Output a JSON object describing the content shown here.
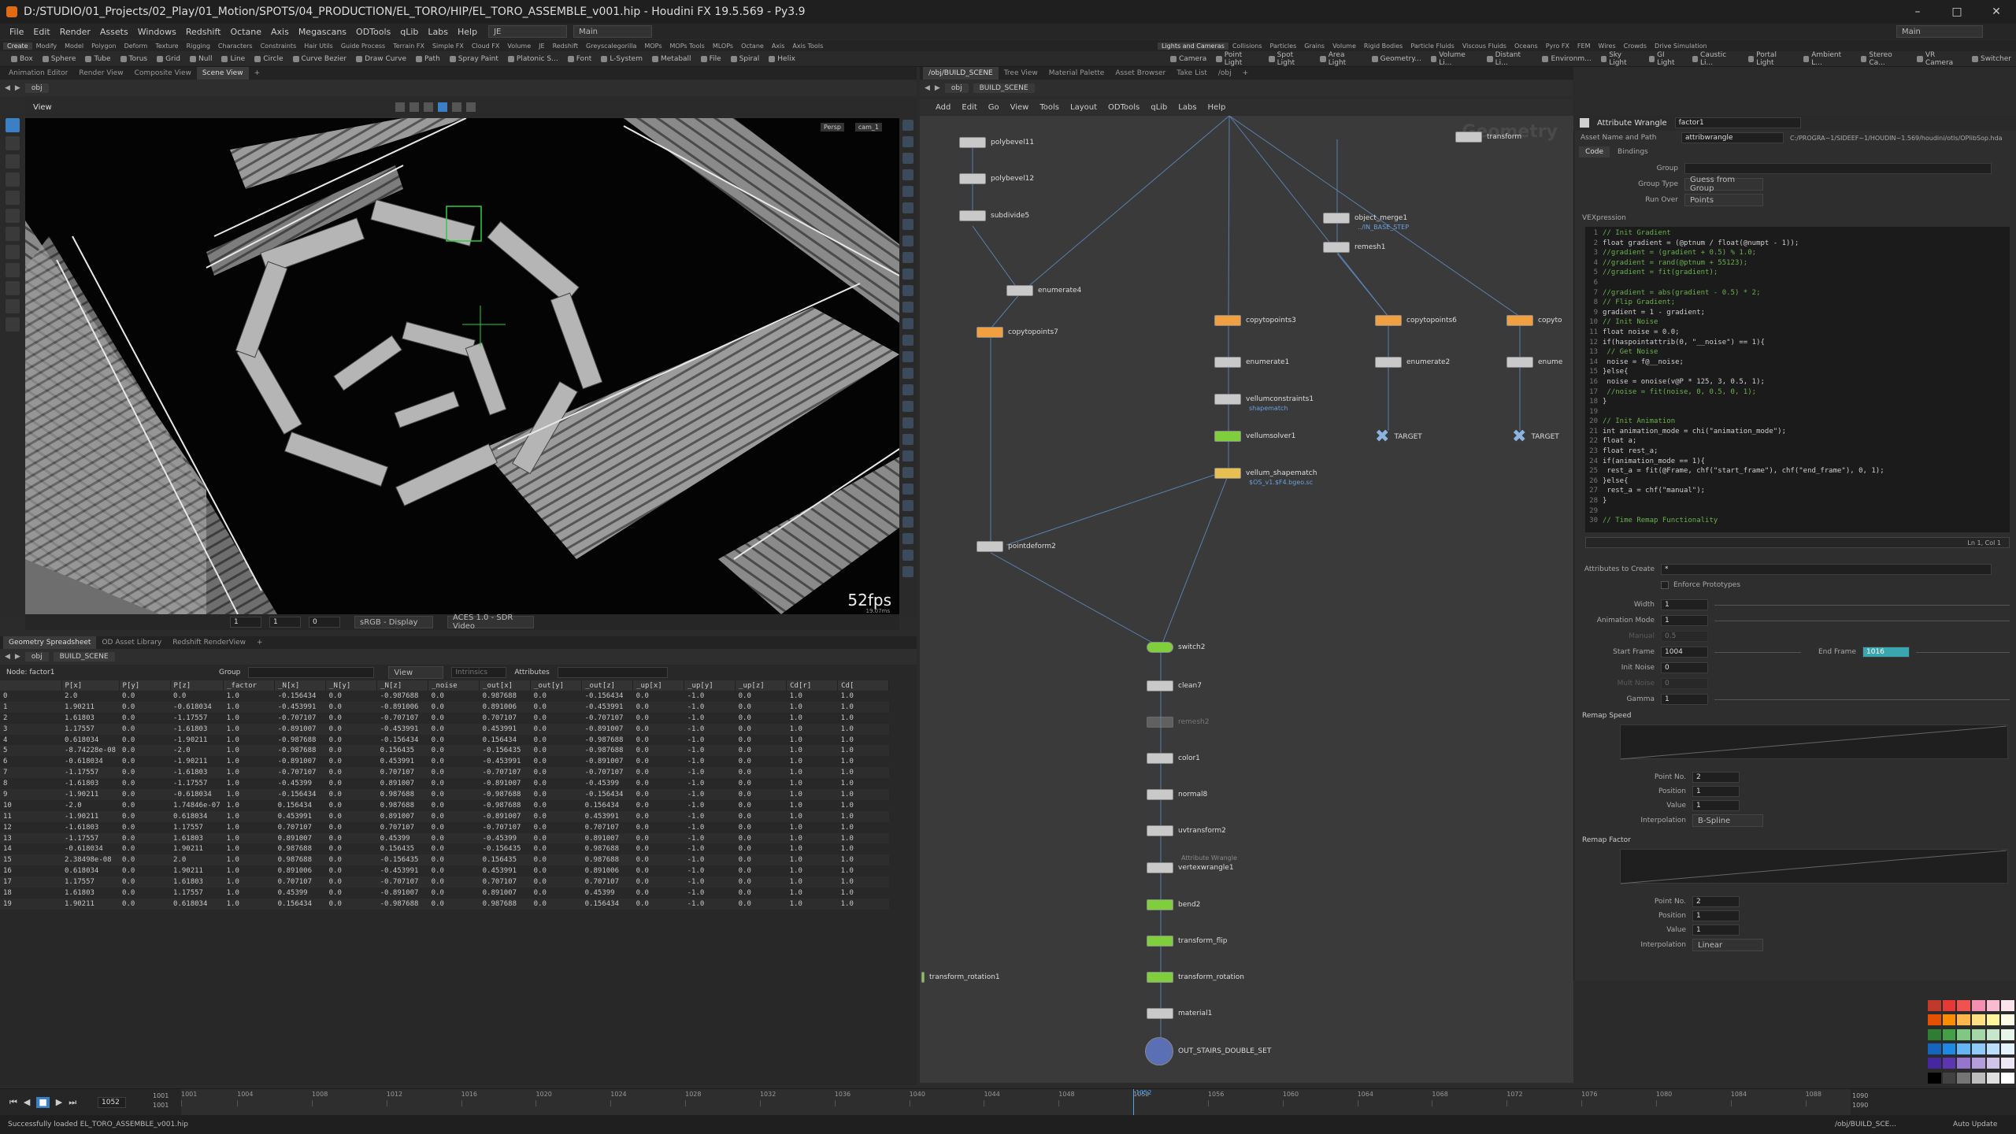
{
  "window": {
    "title": "D:/STUDIO/01_Projects/02_Play/01_Motion/SPOTS/04_PRODUCTION/EL_TORO/HIP/EL_TORO_ASSEMBLE_v001.hip - Houdini FX 19.5.569 - Py3.9"
  },
  "menubar": {
    "items": [
      "File",
      "Edit",
      "Render",
      "Assets",
      "Windows",
      "Redshift",
      "Octane",
      "Axis",
      "Megascans",
      "ODTools",
      "qLib",
      "Labs",
      "Help"
    ],
    "desktop": "JE",
    "layout": "Main",
    "right_layout": "Main"
  },
  "shelf": {
    "tabs": [
      "Create",
      "Modify",
      "Model",
      "Polygon",
      "Deform",
      "Texture",
      "Rigging",
      "Characters",
      "Constraints",
      "Hair Utils",
      "Guide Process",
      "Terrain FX",
      "Simple FX",
      "Cloud FX",
      "Volume",
      "JE",
      "Redshift",
      "Greyscalegorilla",
      "MOPs",
      "MOPs Tools",
      "MLOPs",
      "Octane",
      "Axis",
      "Axis Tools"
    ],
    "tools": [
      "Box",
      "Sphere",
      "Tube",
      "Torus",
      "Grid",
      "Null",
      "Line",
      "Circle",
      "Curve Bezier",
      "Draw Curve",
      "Path",
      "Spray Paint",
      "Platonic S...",
      "Font",
      "L-System",
      "Metaball",
      "File",
      "Spiral",
      "Helix"
    ],
    "right_tabs": [
      "Lights and Cameras",
      "Collisions",
      "Particles",
      "Grains",
      "Volume",
      "Rigid Bodies",
      "Particle Fluids",
      "Viscous Fluids",
      "Oceans",
      "Pyro FX",
      "FEM",
      "Wires",
      "Crowds",
      "Drive Simulation"
    ],
    "right_tools": [
      "Camera",
      "Point Light",
      "Spot Light",
      "Area Light",
      "Geometry...",
      "Volume Li...",
      "Distant Li...",
      "Environm...",
      "Sky Light",
      "GI Light",
      "Caustic Li...",
      "Portal Light",
      "Ambient L...",
      "Stereo Ca...",
      "VR Camera",
      "Switcher"
    ]
  },
  "viewer": {
    "tabs": [
      "Animation Editor",
      "Render View",
      "Composite View",
      "Scene View"
    ],
    "path": "obj",
    "title": "View",
    "persp": "Persp",
    "cam": "cam_1",
    "fps": "52fps",
    "fps_ms": "19.07ms",
    "bottom": {
      "frame1": "1",
      "frame2": "1",
      "frame3": "0",
      "display": "sRGB - Display",
      "view": "ACES 1.0 - SDR Video"
    }
  },
  "spreadsheet": {
    "tabs": [
      "Geometry Spreadsheet",
      "OD Asset Library",
      "Redshift RenderView"
    ],
    "path": "obj",
    "path2": "BUILD_SCENE",
    "node_label": "Node: factor1",
    "group_label": "Group",
    "view_label": "View",
    "intrinsics": "Intrinsics",
    "attributes": "Attributes",
    "columns": [
      "",
      "P[x]",
      "P[y]",
      "P[z]",
      "_factor",
      "_N[x]",
      "_N[y]",
      "_N[z]",
      "_noise",
      "_out[x]",
      "_out[y]",
      "_out[z]",
      "_up[x]",
      "_up[y]",
      "_up[z]",
      "Cd[r]",
      "Cd["
    ],
    "rows": [
      [
        "0",
        "2.0",
        "0.0",
        "0.0",
        "1.0",
        "-0.156434",
        "0.0",
        "-0.987688",
        "0.0",
        "0.987688",
        "0.0",
        "-0.156434",
        "0.0",
        "-1.0",
        "0.0",
        "1.0",
        "1.0"
      ],
      [
        "1",
        "1.90211",
        "0.0",
        "-0.618034",
        "1.0",
        "-0.453991",
        "0.0",
        "-0.891006",
        "0.0",
        "0.891006",
        "0.0",
        "-0.453991",
        "0.0",
        "-1.0",
        "0.0",
        "1.0",
        "1.0"
      ],
      [
        "2",
        "1.61803",
        "0.0",
        "-1.17557",
        "1.0",
        "-0.707107",
        "0.0",
        "-0.707107",
        "0.0",
        "0.707107",
        "0.0",
        "-0.707107",
        "0.0",
        "-1.0",
        "0.0",
        "1.0",
        "1.0"
      ],
      [
        "3",
        "1.17557",
        "0.0",
        "-1.61803",
        "1.0",
        "-0.891007",
        "0.0",
        "-0.453991",
        "0.0",
        "0.453991",
        "0.0",
        "-0.891007",
        "0.0",
        "-1.0",
        "0.0",
        "1.0",
        "1.0"
      ],
      [
        "4",
        "0.618034",
        "0.0",
        "-1.90211",
        "1.0",
        "-0.987688",
        "0.0",
        "-0.156434",
        "0.0",
        "0.156434",
        "0.0",
        "-0.987688",
        "0.0",
        "-1.0",
        "0.0",
        "1.0",
        "1.0"
      ],
      [
        "5",
        "-8.74228e-08",
        "0.0",
        "-2.0",
        "1.0",
        "-0.987688",
        "0.0",
        "0.156435",
        "0.0",
        "-0.156435",
        "0.0",
        "-0.987688",
        "0.0",
        "-1.0",
        "0.0",
        "1.0",
        "1.0"
      ],
      [
        "6",
        "-0.618034",
        "0.0",
        "-1.90211",
        "1.0",
        "-0.891007",
        "0.0",
        "0.453991",
        "0.0",
        "-0.453991",
        "0.0",
        "-0.891007",
        "0.0",
        "-1.0",
        "0.0",
        "1.0",
        "1.0"
      ],
      [
        "7",
        "-1.17557",
        "0.0",
        "-1.61803",
        "1.0",
        "-0.707107",
        "0.0",
        "0.707107",
        "0.0",
        "-0.707107",
        "0.0",
        "-0.707107",
        "0.0",
        "-1.0",
        "0.0",
        "1.0",
        "1.0"
      ],
      [
        "8",
        "-1.61803",
        "0.0",
        "-1.17557",
        "1.0",
        "-0.45399",
        "0.0",
        "0.891007",
        "0.0",
        "-0.891007",
        "0.0",
        "-0.45399",
        "0.0",
        "-1.0",
        "0.0",
        "1.0",
        "1.0"
      ],
      [
        "9",
        "-1.90211",
        "0.0",
        "-0.618034",
        "1.0",
        "-0.156434",
        "0.0",
        "0.987688",
        "0.0",
        "-0.987688",
        "0.0",
        "-0.156434",
        "0.0",
        "-1.0",
        "0.0",
        "1.0",
        "1.0"
      ],
      [
        "10",
        "-2.0",
        "0.0",
        "1.74846e-07",
        "1.0",
        "0.156434",
        "0.0",
        "0.987688",
        "0.0",
        "-0.987688",
        "0.0",
        "0.156434",
        "0.0",
        "-1.0",
        "0.0",
        "1.0",
        "1.0"
      ],
      [
        "11",
        "-1.90211",
        "0.0",
        "0.618034",
        "1.0",
        "0.453991",
        "0.0",
        "0.891007",
        "0.0",
        "-0.891007",
        "0.0",
        "0.453991",
        "0.0",
        "-1.0",
        "0.0",
        "1.0",
        "1.0"
      ],
      [
        "12",
        "-1.61803",
        "0.0",
        "1.17557",
        "1.0",
        "0.707107",
        "0.0",
        "0.707107",
        "0.0",
        "-0.707107",
        "0.0",
        "0.707107",
        "0.0",
        "-1.0",
        "0.0",
        "1.0",
        "1.0"
      ],
      [
        "13",
        "-1.17557",
        "0.0",
        "1.61803",
        "1.0",
        "0.891007",
        "0.0",
        "0.45399",
        "0.0",
        "-0.45399",
        "0.0",
        "0.891007",
        "0.0",
        "-1.0",
        "0.0",
        "1.0",
        "1.0"
      ],
      [
        "14",
        "-0.618034",
        "0.0",
        "1.90211",
        "1.0",
        "0.987688",
        "0.0",
        "0.156435",
        "0.0",
        "-0.156435",
        "0.0",
        "0.987688",
        "0.0",
        "-1.0",
        "0.0",
        "1.0",
        "1.0"
      ],
      [
        "15",
        "2.38498e-08",
        "0.0",
        "2.0",
        "1.0",
        "0.987688",
        "0.0",
        "-0.156435",
        "0.0",
        "0.156435",
        "0.0",
        "0.987688",
        "0.0",
        "-1.0",
        "0.0",
        "1.0",
        "1.0"
      ],
      [
        "16",
        "0.618034",
        "0.0",
        "1.90211",
        "1.0",
        "0.891006",
        "0.0",
        "-0.453991",
        "0.0",
        "0.453991",
        "0.0",
        "0.891006",
        "0.0",
        "-1.0",
        "0.0",
        "1.0",
        "1.0"
      ],
      [
        "17",
        "1.17557",
        "0.0",
        "1.61803",
        "1.0",
        "0.707107",
        "0.0",
        "-0.707107",
        "0.0",
        "0.707107",
        "0.0",
        "0.707107",
        "0.0",
        "-1.0",
        "0.0",
        "1.0",
        "1.0"
      ],
      [
        "18",
        "1.61803",
        "0.0",
        "1.17557",
        "1.0",
        "0.45399",
        "0.0",
        "-0.891007",
        "0.0",
        "0.891007",
        "0.0",
        "0.45399",
        "0.0",
        "-1.0",
        "0.0",
        "1.0",
        "1.0"
      ],
      [
        "19",
        "1.90211",
        "0.0",
        "0.618034",
        "1.0",
        "0.156434",
        "0.0",
        "-0.987688",
        "0.0",
        "0.987688",
        "0.0",
        "0.156434",
        "0.0",
        "-1.0",
        "0.0",
        "1.0",
        "1.0"
      ]
    ]
  },
  "network": {
    "tabs": [
      "/obj/BUILD_SCENE",
      "Tree View",
      "Material Palette",
      "Asset Browser",
      "Take List",
      "/obj"
    ],
    "path": "obj",
    "path2": "BUILD_SCENE",
    "menu": [
      "Add",
      "Edit",
      "Go",
      "View",
      "Tools",
      "Layout",
      "ODTools",
      "qLib",
      "Labs",
      "Help"
    ],
    "watermark": "Geometry",
    "nodes": [
      {
        "label": "polybevel11",
        "sub": ""
      },
      {
        "label": "polybevel12",
        "sub": ""
      },
      {
        "label": "subdivide5",
        "sub": ""
      },
      {
        "label": "enumerate4",
        "sub": ""
      },
      {
        "label": "copytopoints7",
        "sub": ""
      },
      {
        "label": "copytopoints3",
        "sub": ""
      },
      {
        "label": "enumerate1",
        "sub": ""
      },
      {
        "label": "vellumconstraints1",
        "sub": "shapematch"
      },
      {
        "label": "vellumsolver1",
        "sub": ""
      },
      {
        "label": "vellum_shapematch",
        "sub": "$OS_v1.$F4.bgeo.sc"
      },
      {
        "label": "pointdeform2",
        "sub": ""
      },
      {
        "label": "object_merge1",
        "sub": "../IN_BASE_STEP"
      },
      {
        "label": "remesh1",
        "sub": ""
      },
      {
        "label": "transform",
        "sub": ""
      },
      {
        "label": "copytopoints6",
        "sub": ""
      },
      {
        "label": "enumerate2",
        "sub": ""
      },
      {
        "label": "TARGET",
        "sub": ""
      },
      {
        "label": "copyto",
        "sub": ""
      },
      {
        "label": "enume",
        "sub": ""
      },
      {
        "label": "TARGET",
        "sub": ""
      },
      {
        "label": "switch2",
        "sub": ""
      },
      {
        "label": "clean7",
        "sub": ""
      },
      {
        "label": "remesh2",
        "sub": ""
      },
      {
        "label": "color1",
        "sub": ""
      },
      {
        "label": "normal8",
        "sub": ""
      },
      {
        "label": "uvtransform2",
        "sub": ""
      },
      {
        "label": "vertexwrangle1",
        "sub": "Attribute Wrangle"
      },
      {
        "label": "bend2",
        "sub": ""
      },
      {
        "label": "transform_flip",
        "sub": ""
      },
      {
        "label": "transform_rotation",
        "sub": ""
      },
      {
        "label": "material1",
        "sub": ""
      },
      {
        "label": "OUT_STAIRS_DOUBLE_SET",
        "sub": ""
      },
      {
        "label": "transform_rotation1",
        "sub": ""
      }
    ]
  },
  "params": {
    "type": "Attribute Wrangle",
    "name": "factor1",
    "asset_label": "Asset Name and Path",
    "asset_name": "attribwrangle",
    "asset_path": "C:/PROGRA~1/SIDEEF~1/HOUDIN~1.569/houdini/otls/OPlibSop.hda",
    "tabs": [
      "Code",
      "Bindings"
    ],
    "group_label": "Group",
    "group_type_label": "Group Type",
    "group_type": "Guess from Group",
    "run_over_label": "Run Over",
    "run_over": "Points",
    "vex_label": "VEXpression",
    "cursor": "Ln 1, Col 1",
    "code": [
      "// Init Gradient",
      "float gradient = (@ptnum / float(@numpt - 1));",
      "//gradient = (gradient + 0.5) % 1.0;",
      "//gradient = rand(@ptnum + 55123);",
      "//gradient = fit(gradient);",
      "",
      "//gradient =  abs(gradient - 0.5) * 2;",
      "// Flip Gradient;",
      "gradient = 1 - gradient;",
      "// Init Noise",
      "float noise = 0.0;",
      "if(haspointattrib(0, \"__noise\") == 1){",
      "    // Get Noise",
      "    noise = f@__noise;",
      "}else{",
      "    noise = onoise(v@P * 125, 3, 0.5, 1);",
      "    //noise = fit(noise, 0, 0.5, 0, 1);",
      "}",
      "",
      "// Init Animation",
      "int animation_mode = chi(\"animation_mode\");",
      "float a;",
      "float rest_a;",
      "if(animation_mode == 1){",
      "    rest_a = fit(@Frame, chf(\"start_frame\"), chf(\"end_frame\"), 0, 1);",
      "}else{",
      "    rest_a = chf(\"manual\");",
      "}",
      "",
      "// Time Remap Functionality"
    ],
    "attrs_label": "Attributes to Create",
    "attrs_value": "*",
    "enforce": "Enforce Prototypes",
    "width_label": "Width",
    "width": "1",
    "anim_label": "Animation Mode",
    "anim": "1",
    "manual_label": "Manual",
    "manual": "0.5",
    "start_label": "Start Frame",
    "start": "1004",
    "end_label": "End Frame",
    "end": "1016",
    "initnoise_label": "Init Noise",
    "initnoise": "0",
    "mult_label": "Mult Noise",
    "mult": "0",
    "gamma_label": "Gamma",
    "gamma": "1",
    "remap_speed": "Remap Speed",
    "remap_factor": "Remap Factor",
    "pointno_label": "Point No.",
    "pointno": "2",
    "position_label": "Position",
    "position": "1",
    "value_label": "Value",
    "value": "1",
    "interp_label": "Interpolation",
    "interp_speed": "B-Spline",
    "interp_factor": "Linear"
  },
  "swatches": [
    "#c0392b",
    "#e53935",
    "#ef5350",
    "#f48fb1",
    "#f8bbd0",
    "#fce4ec",
    "#e65100",
    "#fb8c00",
    "#ffb74d",
    "#ffe082",
    "#fff59d",
    "#fffde7",
    "#2e7d32",
    "#43a047",
    "#81c784",
    "#a5d6a7",
    "#c8e6c9",
    "#e8f5e9",
    "#1565c0",
    "#1e88e5",
    "#64b5f6",
    "#90caf9",
    "#bbdefb",
    "#e3f2fd",
    "#4527a0",
    "#5e35b1",
    "#9575cd",
    "#b39ddb",
    "#d1c4e9",
    "#ede7f6",
    "#000000",
    "#424242",
    "#757575",
    "#bdbdbd",
    "#e0e0e0",
    "#ffffff"
  ],
  "timeline": {
    "current": "1052",
    "start1": "1001",
    "start2": "1001",
    "end1": "1090",
    "end2": "1090",
    "marker": "1052",
    "ticks": [
      "1001",
      "1004",
      "1008",
      "1012",
      "1016",
      "1020",
      "1024",
      "1028",
      "1032",
      "1036",
      "1040",
      "1044",
      "1048",
      "1052",
      "1056",
      "1060",
      "1064",
      "1068",
      "1072",
      "1076",
      "1080",
      "1084",
      "1088"
    ],
    "auto_update": "Auto Update",
    "path": "/obj/BUILD_SCE..."
  },
  "status": {
    "text": "Successfully loaded EL_TORO_ASSEMBLE_v001.hip"
  }
}
